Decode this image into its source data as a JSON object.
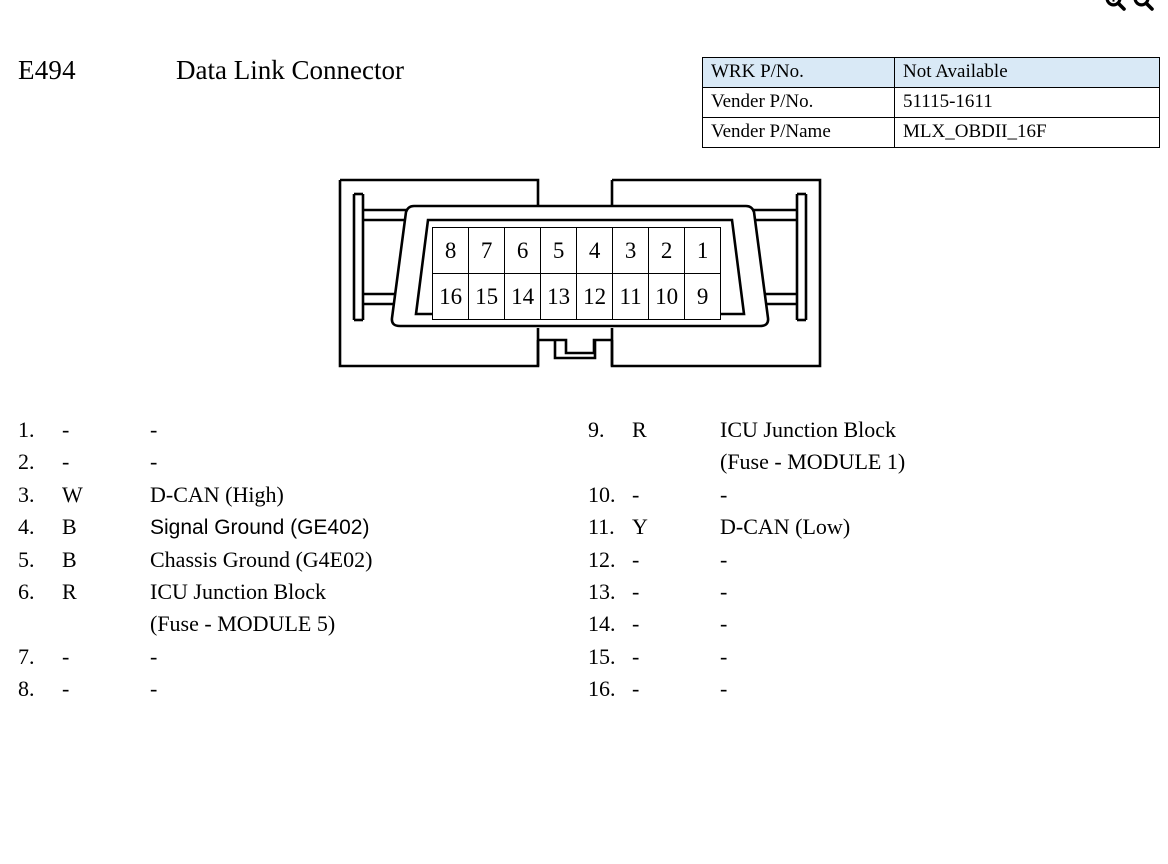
{
  "page": {
    "connector_code": "E494",
    "connector_title": "Data Link Connector"
  },
  "toolbar": {
    "icons": [
      {
        "name": "zoom-in-icon",
        "glyph": "zoom-in"
      },
      {
        "name": "zoom-out-icon",
        "glyph": "zoom-out"
      }
    ]
  },
  "info_table": {
    "rows": [
      {
        "label": "WRK P/No.",
        "value": "Not Available",
        "highlight": true
      },
      {
        "label": "Vender P/No.",
        "value": "51115-1611",
        "highlight": false
      },
      {
        "label": "Vender P/Name",
        "value": "MLX_OBDII_16F",
        "highlight": false
      }
    ],
    "header_bg": "#d9e9f6"
  },
  "connector_diagram": {
    "type": "obdii-16-pin-female",
    "pin_grid": {
      "columns": 8,
      "rows": 2,
      "top_row": [
        "8",
        "7",
        "6",
        "5",
        "4",
        "3",
        "2",
        "1"
      ],
      "bottom_row": [
        "16",
        "15",
        "14",
        "13",
        "12",
        "11",
        "10",
        "9"
      ]
    }
  },
  "pin_list": {
    "left_column": [
      {
        "id": "1.",
        "color": "-",
        "desc": "-",
        "font": "serif",
        "cont": null
      },
      {
        "id": "2.",
        "color": "-",
        "desc": "-",
        "font": "serif",
        "cont": null
      },
      {
        "id": "3.",
        "color": "W",
        "desc": "D-CAN (High)",
        "font": "serif",
        "cont": null
      },
      {
        "id": "4.",
        "color": "B",
        "desc": "Signal Ground (GE402)",
        "font": "sans",
        "cont": null
      },
      {
        "id": "5.",
        "color": "B",
        "desc": "Chassis Ground (G4E02)",
        "font": "serif",
        "cont": null
      },
      {
        "id": "6.",
        "color": "R",
        "desc": "ICU Junction Block",
        "font": "serif",
        "cont": "(Fuse - MODULE 5)"
      },
      {
        "id": "7.",
        "color": "-",
        "desc": "-",
        "font": "serif",
        "cont": null
      },
      {
        "id": "8.",
        "color": "-",
        "desc": "-",
        "font": "serif",
        "cont": null
      }
    ],
    "right_column": [
      {
        "id": "9.",
        "color": "R",
        "desc": "ICU Junction Block",
        "font": "serif",
        "cont": "(Fuse - MODULE 1)"
      },
      {
        "id": "10.",
        "color": "-",
        "desc": "-",
        "font": "serif",
        "cont": null
      },
      {
        "id": "11.",
        "color": "Y",
        "desc": "D-CAN (Low)",
        "font": "serif",
        "cont": null
      },
      {
        "id": "12.",
        "color": "-",
        "desc": "-",
        "font": "serif",
        "cont": null
      },
      {
        "id": "13.",
        "color": "-",
        "desc": "-",
        "font": "serif",
        "cont": null
      },
      {
        "id": "14.",
        "color": "-",
        "desc": "-",
        "font": "serif",
        "cont": null
      },
      {
        "id": "15.",
        "color": "-",
        "desc": "-",
        "font": "serif",
        "cont": null
      },
      {
        "id": "16.",
        "color": "-",
        "desc": "-",
        "font": "serif",
        "cont": null
      }
    ]
  }
}
